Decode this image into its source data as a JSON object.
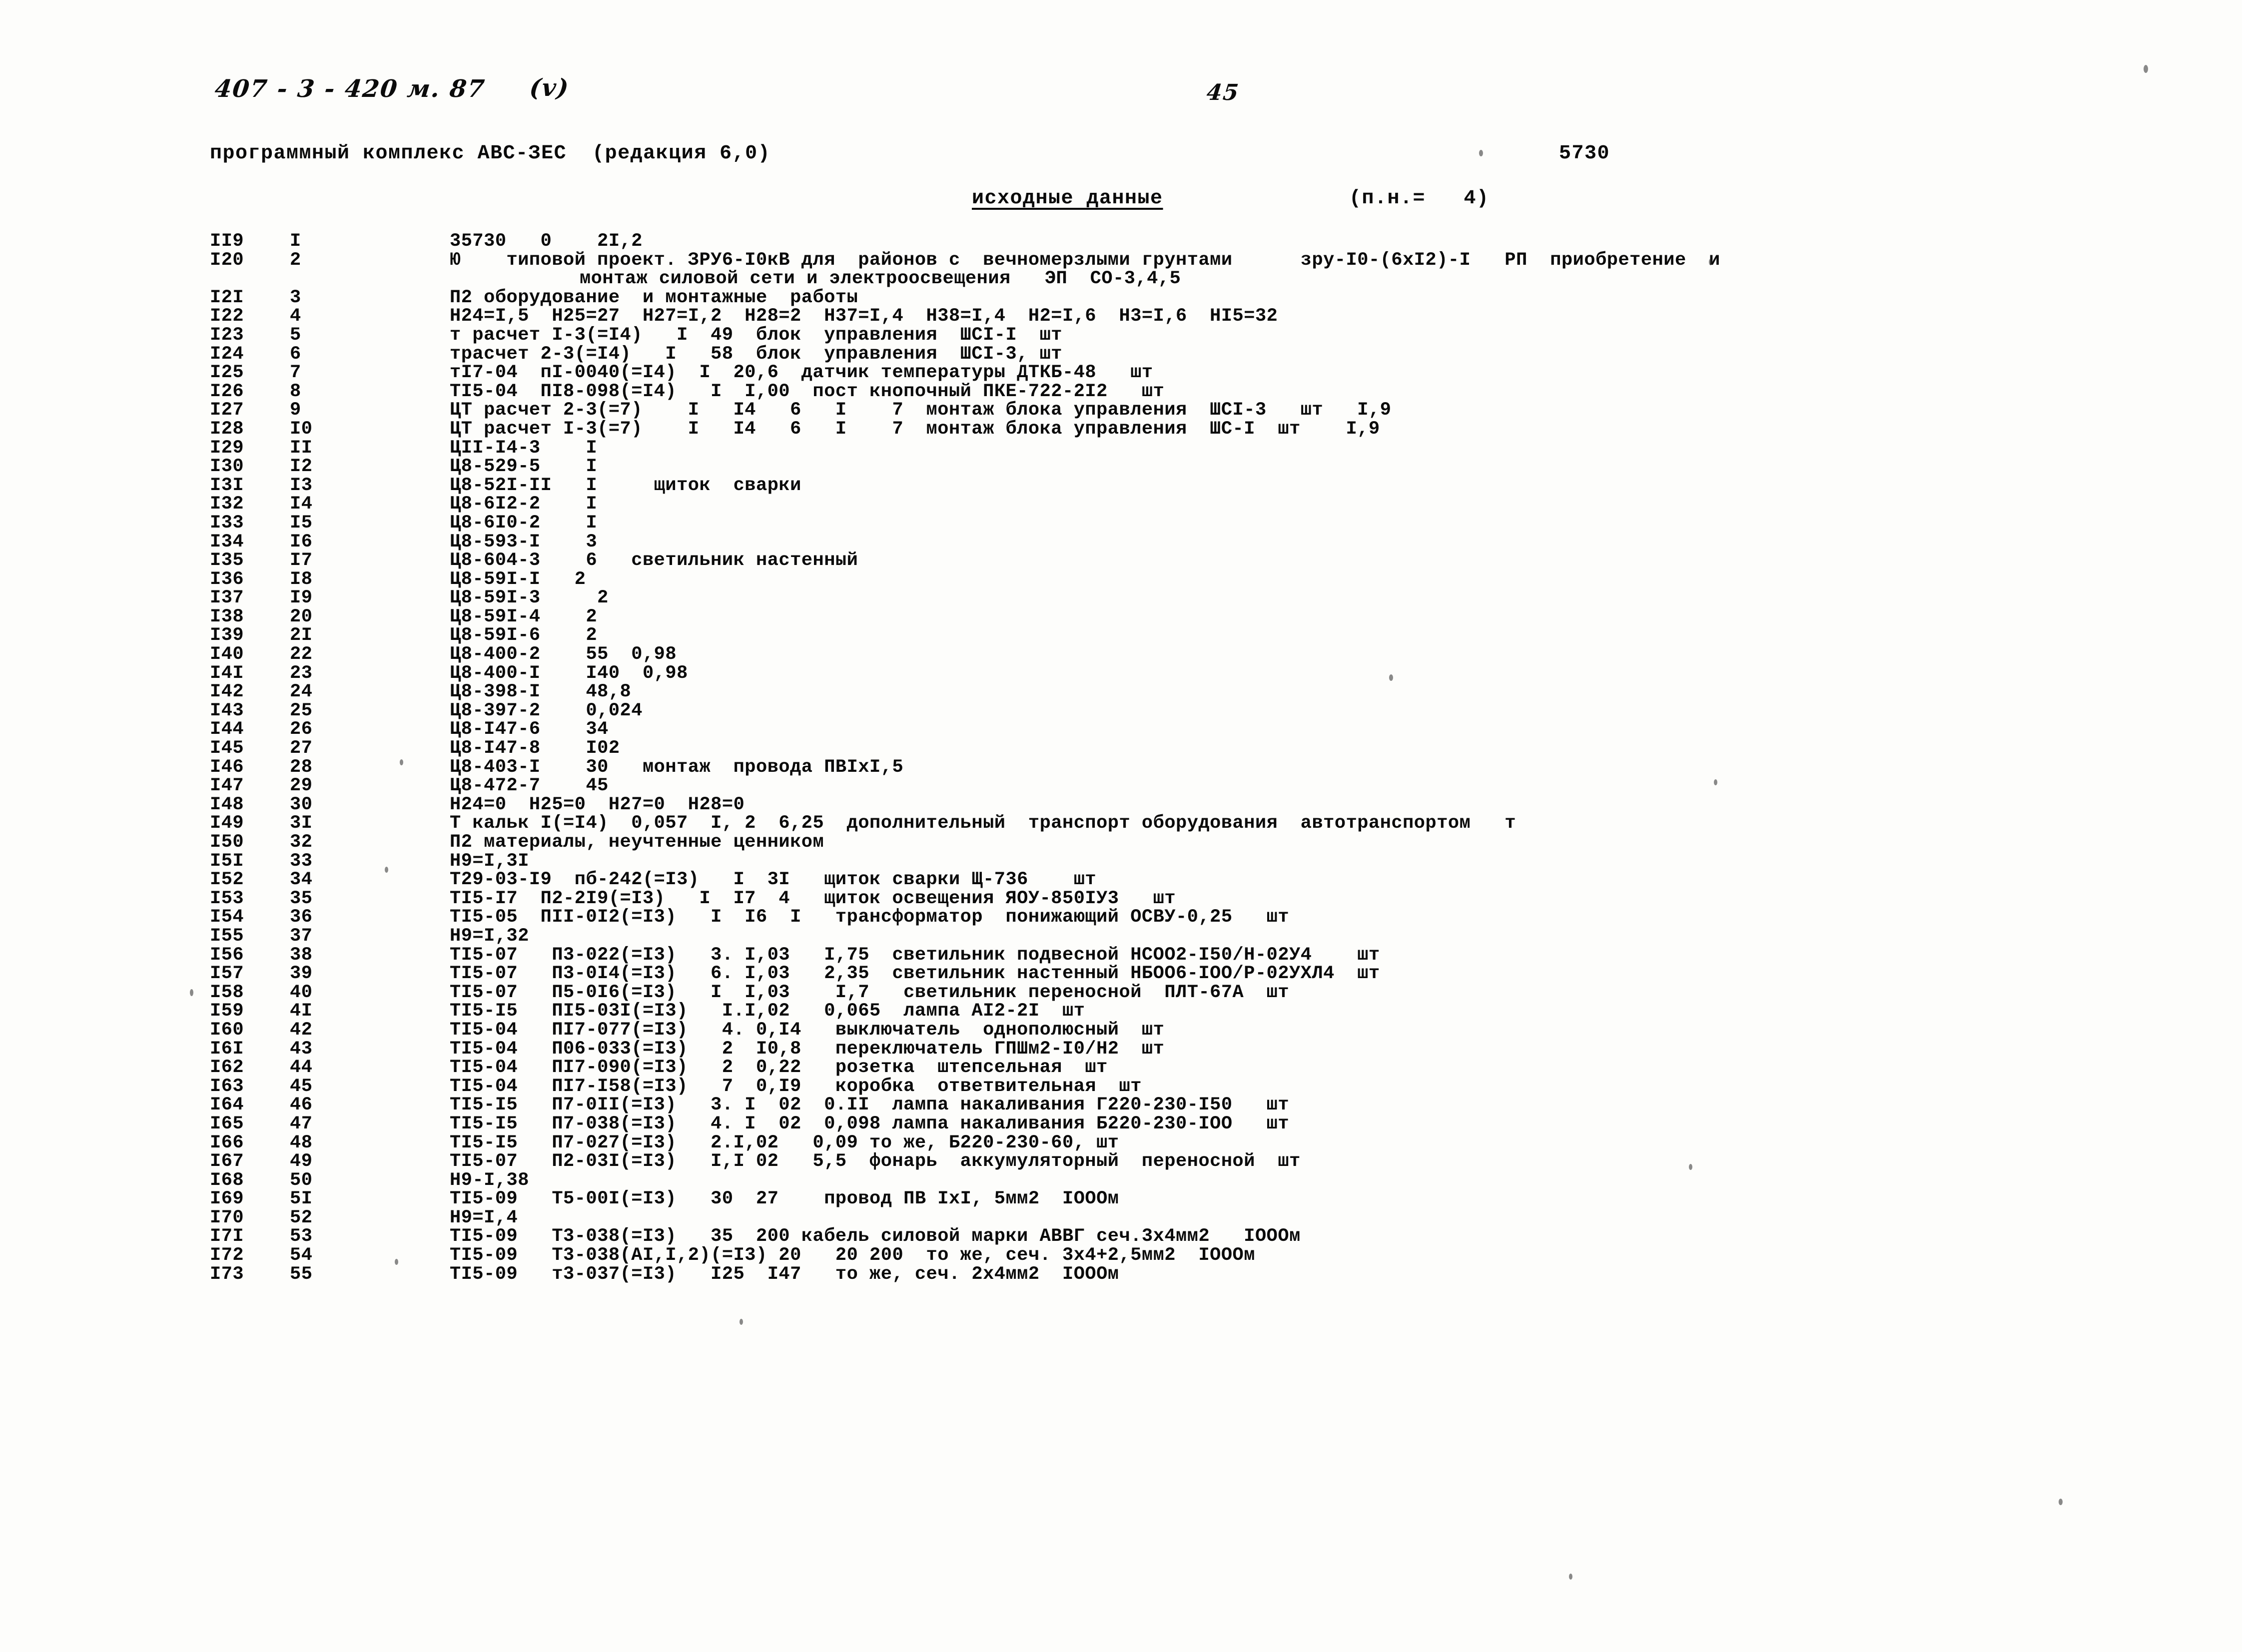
{
  "annotations": {
    "project_code": "407 - 3 - 420 м. 87",
    "variant": "(v)",
    "page_number": "45"
  },
  "header": {
    "program_title": "программный комплекс АВС-ЗЕС  (редакция 6,0)",
    "document_number": "5730",
    "section_title": "исходные данные",
    "pn_label": "(п.н.=   4)"
  },
  "listing": {
    "rows": [
      {
        "seq": "II9",
        "idx": "I",
        "body": "35730   0    2I,2"
      },
      {
        "seq": "I20",
        "idx": "2",
        "body": "Ю    типовой проект. ЗРУ6-I0кВ для  районов с  вечномерзлыми грунтами      зру-I0-(6хI2)-I   РП  приобретение  и"
      },
      {
        "seq": "",
        "idx": "",
        "body": "монтаж силовой сети и электроосвещения   ЭП  СО-3,4,5",
        "indent": true
      },
      {
        "seq": "I2I",
        "idx": "3",
        "body": "П2 оборудование  и монтажные  работы"
      },
      {
        "seq": "I22",
        "idx": "4",
        "body": "Н24=I,5  Н25=27  Н27=I,2  Н28=2  Н37=I,4  Н38=I,4  Н2=I,6  Н3=I,6  НI5=32"
      },
      {
        "seq": "I23",
        "idx": "5",
        "body": "т расчет I-3(=I4)   I  49  блок  управления  ШСI-I  шт"
      },
      {
        "seq": "I24",
        "idx": "6",
        "body": "трасчет 2-3(=I4)   I   58  блок  управления  ШСI-3, шт"
      },
      {
        "seq": "I25",
        "idx": "7",
        "body": "тI7-04  пI-0040(=I4)  I  20,6  датчик температуры ДТКБ-48   шт"
      },
      {
        "seq": "I26",
        "idx": "8",
        "body": "ТI5-04  ПI8-098(=I4)   I  I,00  пост кнопочный ПКЕ-722-2I2   шт"
      },
      {
        "seq": "I27",
        "idx": "9",
        "body": "ЦТ расчет 2-3(=7)    I   I4   6   I    7  монтаж блока управления  ШСI-3   шт   I,9"
      },
      {
        "seq": "I28",
        "idx": "I0",
        "body": "ЦТ расчет I-3(=7)    I   I4   6   I    7  монтаж блока управления  ШС-I  шт    I,9"
      },
      {
        "seq": "I29",
        "idx": "II",
        "body": "ЦII-I4-3    I"
      },
      {
        "seq": "I30",
        "idx": "I2",
        "body": "Ц8-529-5    I"
      },
      {
        "seq": "I3I",
        "idx": "I3",
        "body": "Ц8-52I-II   I     щиток  сварки"
      },
      {
        "seq": "I32",
        "idx": "I4",
        "body": "Ц8-6I2-2    I"
      },
      {
        "seq": "I33",
        "idx": "I5",
        "body": "Ц8-6I0-2    I"
      },
      {
        "seq": "I34",
        "idx": "I6",
        "body": "Ц8-593-I    3"
      },
      {
        "seq": "I35",
        "idx": "I7",
        "body": "Ц8-604-3    6   светильник настенный"
      },
      {
        "seq": "I36",
        "idx": "I8",
        "body": "Ц8-59I-I   2"
      },
      {
        "seq": "I37",
        "idx": "I9",
        "body": "Ц8-59I-3     2"
      },
      {
        "seq": "I38",
        "idx": "20",
        "body": "Ц8-59I-4    2"
      },
      {
        "seq": "I39",
        "idx": "2I",
        "body": "Ц8-59I-6    2"
      },
      {
        "seq": "I40",
        "idx": "22",
        "body": "Ц8-400-2    55  0,98"
      },
      {
        "seq": "I4I",
        "idx": "23",
        "body": "Ц8-400-I    I40  0,98"
      },
      {
        "seq": "I42",
        "idx": "24",
        "body": "Ц8-398-I    48,8"
      },
      {
        "seq": "I43",
        "idx": "25",
        "body": "Ц8-397-2    0,024"
      },
      {
        "seq": "I44",
        "idx": "26",
        "body": "Ц8-I47-6    34"
      },
      {
        "seq": "I45",
        "idx": "27",
        "body": "Ц8-I47-8    I02"
      },
      {
        "seq": "I46",
        "idx": "28",
        "body": "Ц8-403-I    30   монтаж  провода ПВIхI,5"
      },
      {
        "seq": "I47",
        "idx": "29",
        "body": "Ц8-472-7    45"
      },
      {
        "seq": "I48",
        "idx": "30",
        "body": "Н24=0  Н25=0  Н27=0  Н28=0"
      },
      {
        "seq": "I49",
        "idx": "3I",
        "body": "Т кальк I(=I4)  0,057  I, 2  6,25  дополнительный  транспорт оборудования  автотранспортом   т"
      },
      {
        "seq": "I50",
        "idx": "32",
        "body": "П2 материалы, неучтенные ценником"
      },
      {
        "seq": "I5I",
        "idx": "33",
        "body": "Н9=I,3I"
      },
      {
        "seq": "I52",
        "idx": "34",
        "body": "Т29-03-I9  пб-242(=I3)   I  3I   щиток сварки Щ-736    шт"
      },
      {
        "seq": "I53",
        "idx": "35",
        "body": "ТI5-I7  П2-2I9(=I3)   I  I7  4   щиток освещения ЯОУ-850IУ3   шт"
      },
      {
        "seq": "I54",
        "idx": "36",
        "body": "ТI5-05  ПII-0I2(=I3)   I  I6  I   трансформатор  понижающий ОСВУ-0,25   шт"
      },
      {
        "seq": "I55",
        "idx": "37",
        "body": "Н9=I,32"
      },
      {
        "seq": "I56",
        "idx": "38",
        "body": "ТI5-07   П3-022(=I3)   3. I,03   I,75  светильник подвесной НСОО2-I50/Н-02У4    шт"
      },
      {
        "seq": "I57",
        "idx": "39",
        "body": "ТI5-07   П3-0I4(=I3)   6. I,03   2,35  светильник настенный НБОО6-IОО/Р-02УХЛ4  шт"
      },
      {
        "seq": "I58",
        "idx": "40",
        "body": "ТI5-07   П5-0I6(=I3)   I  I,03    I,7   светильник переносной  ПЛТ-67А  шт"
      },
      {
        "seq": "I59",
        "idx": "4I",
        "body": "ТI5-I5   ПI5-03I(=I3)   I.I,02   0,065  лампа АI2-2I  шт"
      },
      {
        "seq": "I60",
        "idx": "42",
        "body": "ТI5-04   ПI7-077(=I3)   4. 0,I4   выключатель  однополюсный  шт"
      },
      {
        "seq": "I6I",
        "idx": "43",
        "body": "ТI5-04   П06-033(=I3)   2  I0,8   переключатель ГПШм2-I0/Н2  шт"
      },
      {
        "seq": "I62",
        "idx": "44",
        "body": "ТI5-04   ПI7-090(=I3)   2  0,22   розетка  штепсельная  шт"
      },
      {
        "seq": "I63",
        "idx": "45",
        "body": "ТI5-04   ПI7-I58(=I3)   7  0,I9   коробка  ответвительная  шт"
      },
      {
        "seq": "I64",
        "idx": "46",
        "body": "ТI5-I5   П7-0II(=I3)   3. I  02  0.II  лампа накаливания Г220-230-I50   шт"
      },
      {
        "seq": "I65",
        "idx": "47",
        "body": "ТI5-I5   П7-038(=I3)   4. I  02  0,098 лампа накаливания Б220-230-IОО   шт"
      },
      {
        "seq": "I66",
        "idx": "48",
        "body": "ТI5-I5   П7-027(=I3)   2.I,02   0,09 то же, Б220-230-60, шт"
      },
      {
        "seq": "I67",
        "idx": "49",
        "body": "ТI5-07   П2-03I(=I3)   I,I 02   5,5  фонарь  аккумуляторный  переносной  шт"
      },
      {
        "seq": "I68",
        "idx": "50",
        "body": "Н9-I,38"
      },
      {
        "seq": "I69",
        "idx": "5I",
        "body": "ТI5-09   Т5-00I(=I3)   30  27    провод ПВ IхI, 5мм2  IОООм"
      },
      {
        "seq": "I70",
        "idx": "52",
        "body": "Н9=I,4"
      },
      {
        "seq": "I7I",
        "idx": "53",
        "body": "ТI5-09   Т3-038(=I3)   35  200 кабель силовой марки АВВГ сеч.3х4мм2   IОООм"
      },
      {
        "seq": "I72",
        "idx": "54",
        "body": "ТI5-09   Т3-038(АI,I,2)(=I3) 20   20 200  то же, сеч. 3х4+2,5мм2  IОООм"
      },
      {
        "seq": "I73",
        "idx": "55",
        "body": "ТI5-09   т3-037(=I3)   I25  I47   то же, сеч. 2х4мм2  IОООм"
      }
    ]
  }
}
